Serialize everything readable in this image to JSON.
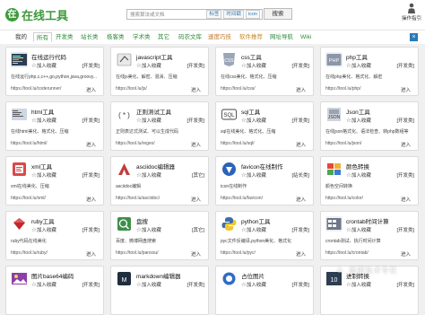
{
  "header": {
    "logo_mark": "在",
    "logo_text": "在线工具",
    "search_placeholder": "搜索算法或文档",
    "filters": [
      "标签",
      "时间戳",
      "icon"
    ],
    "search_button": "搜索",
    "guide_label": "操作指引"
  },
  "tabs": [
    {
      "label": "我的",
      "style": "plain"
    },
    {
      "label": "所有",
      "style": "active"
    },
    {
      "label": "开发类",
      "style": "green"
    },
    {
      "label": "站长类",
      "style": "green"
    },
    {
      "label": "极客类",
      "style": "green"
    },
    {
      "label": "学术类",
      "style": "green"
    },
    {
      "label": "其它",
      "style": "green"
    },
    {
      "label": "码农文库",
      "style": "green"
    },
    {
      "label": "速度巧技",
      "style": "orange"
    },
    {
      "label": "软件推荐",
      "style": "gold"
    },
    {
      "label": "网址导航",
      "style": "green"
    },
    {
      "label": "Wiki",
      "style": "green"
    }
  ],
  "tab_close": "×",
  "cards": [
    {
      "title": "在线运行代码",
      "fav": "加入收藏",
      "tag": "[开发类]",
      "desc": "在线运行php,c,c++,go,python,java,groovy...",
      "url": "https://tool.lu/coderunner/",
      "go": "进入",
      "icon": "code"
    },
    {
      "title": "javascript工具",
      "fav": "加入收藏",
      "tag": "[开发类]",
      "desc": "在线js美化、解密、混淆、压缩",
      "url": "https://tool.lu/js/",
      "go": "进入",
      "icon": "js"
    },
    {
      "title": "css工具",
      "fav": "加入收藏",
      "tag": "[开发类]",
      "desc": "在线css美化、格式化、压缩",
      "url": "https://tool.lu/css/",
      "go": "进入",
      "icon": "css"
    },
    {
      "title": "php工具",
      "fav": "加入收藏",
      "tag": "[开发类]",
      "desc": "在线php美化、格式化、解密",
      "url": "https://tool.lu/php/",
      "go": "进入",
      "icon": "php"
    },
    {
      "title": "html工具",
      "fav": "加入收藏",
      "tag": "[开发类]",
      "desc": "在线html美化、格式化、压缩",
      "url": "https://tool.lu/html/",
      "go": "进入",
      "icon": "html"
    },
    {
      "title": "正则测试工具",
      "fav": "加入收藏",
      "tag": "[开发类]",
      "desc": "正则表达式测试、可以生成代码",
      "url": "https://tool.lu/regex/",
      "go": "进入",
      "icon": "regex"
    },
    {
      "title": "sql工具",
      "fav": "加入收藏",
      "tag": "[开发类]",
      "desc": "sql在线美化、格式化、压缩",
      "url": "https://tool.lu/sql/",
      "go": "进入",
      "icon": "sql"
    },
    {
      "title": "Json工具",
      "fav": "加入收藏",
      "tag": "[开发类]",
      "desc": "在线json格式化、语法检查、转php数组等",
      "url": "https://tool.lu/json/",
      "go": "进入",
      "icon": "json"
    },
    {
      "title": "xml工具",
      "fav": "加入收藏",
      "tag": "[开发类]",
      "desc": "xml在线美化、压缩",
      "url": "https://tool.lu/xml/",
      "go": "进入",
      "icon": "xml"
    },
    {
      "title": "asciidoc编辑器",
      "fav": "加入收藏",
      "tag": "[其它]",
      "desc": "asciidoc编辑",
      "url": "https://tool.lu/asciidoc/",
      "go": "进入",
      "icon": "asciidoc"
    },
    {
      "title": "favicon在线制作",
      "fav": "加入收藏",
      "tag": "[站长类]",
      "desc": "icon在线制作",
      "url": "https://tool.lu/favicon/",
      "go": "进入",
      "icon": "favicon"
    },
    {
      "title": "颜色转换",
      "fav": "加入收藏",
      "tag": "[开发类]",
      "desc": "颜色空间转换",
      "url": "https://tool.lu/color/",
      "go": "进入",
      "icon": "color"
    },
    {
      "title": "ruby工具",
      "fav": "加入收藏",
      "tag": "[开发类]",
      "desc": "ruby代码在线美化",
      "url": "https://tool.lu/ruby/",
      "go": "进入",
      "icon": "ruby"
    },
    {
      "title": "盘搜",
      "fav": "加入收藏",
      "tag": "[其它]",
      "desc": "百度、微博网盘搜索",
      "url": "https://tool.lu/pansou/",
      "go": "进入",
      "icon": "pansou"
    },
    {
      "title": "python工具",
      "fav": "加入收藏",
      "tag": "[开发类]",
      "desc": "pyc文件反编译,python美化、格式化",
      "url": "https://tool.lu/pyc/",
      "go": "进入",
      "icon": "python"
    },
    {
      "title": "crontab时间计算",
      "fav": "加入收藏",
      "tag": "[开发类]",
      "desc": "crontab测试、执行时间计算",
      "url": "https://tool.lu/crontab/",
      "go": "进入",
      "icon": "crontab"
    },
    {
      "title": "图片base64编码",
      "fav": "加入收藏",
      "tag": "[开发类]",
      "desc": "",
      "url": "",
      "go": "",
      "icon": "base64"
    },
    {
      "title": "markdown编辑器",
      "fav": "加入收藏",
      "tag": "[开发类]",
      "desc": "",
      "url": "",
      "go": "",
      "icon": "markdown"
    },
    {
      "title": "占位图片",
      "fav": "加入收藏",
      "tag": "[开发类]",
      "desc": "",
      "url": "",
      "go": "",
      "icon": "placeholder"
    },
    {
      "title": "进制转换",
      "fav": "加入收藏",
      "tag": "[开发类]",
      "desc": "",
      "url": "",
      "go": "",
      "icon": "radix"
    }
  ],
  "watermark": "©. 微服技术专栏",
  "colors": {
    "brand": "#3d9a3a",
    "tab_green": "#2e8b3a",
    "tab_orange": "#c0782c",
    "tab_gold": "#c78a1d",
    "accent_blue": "#2a7ab8"
  }
}
